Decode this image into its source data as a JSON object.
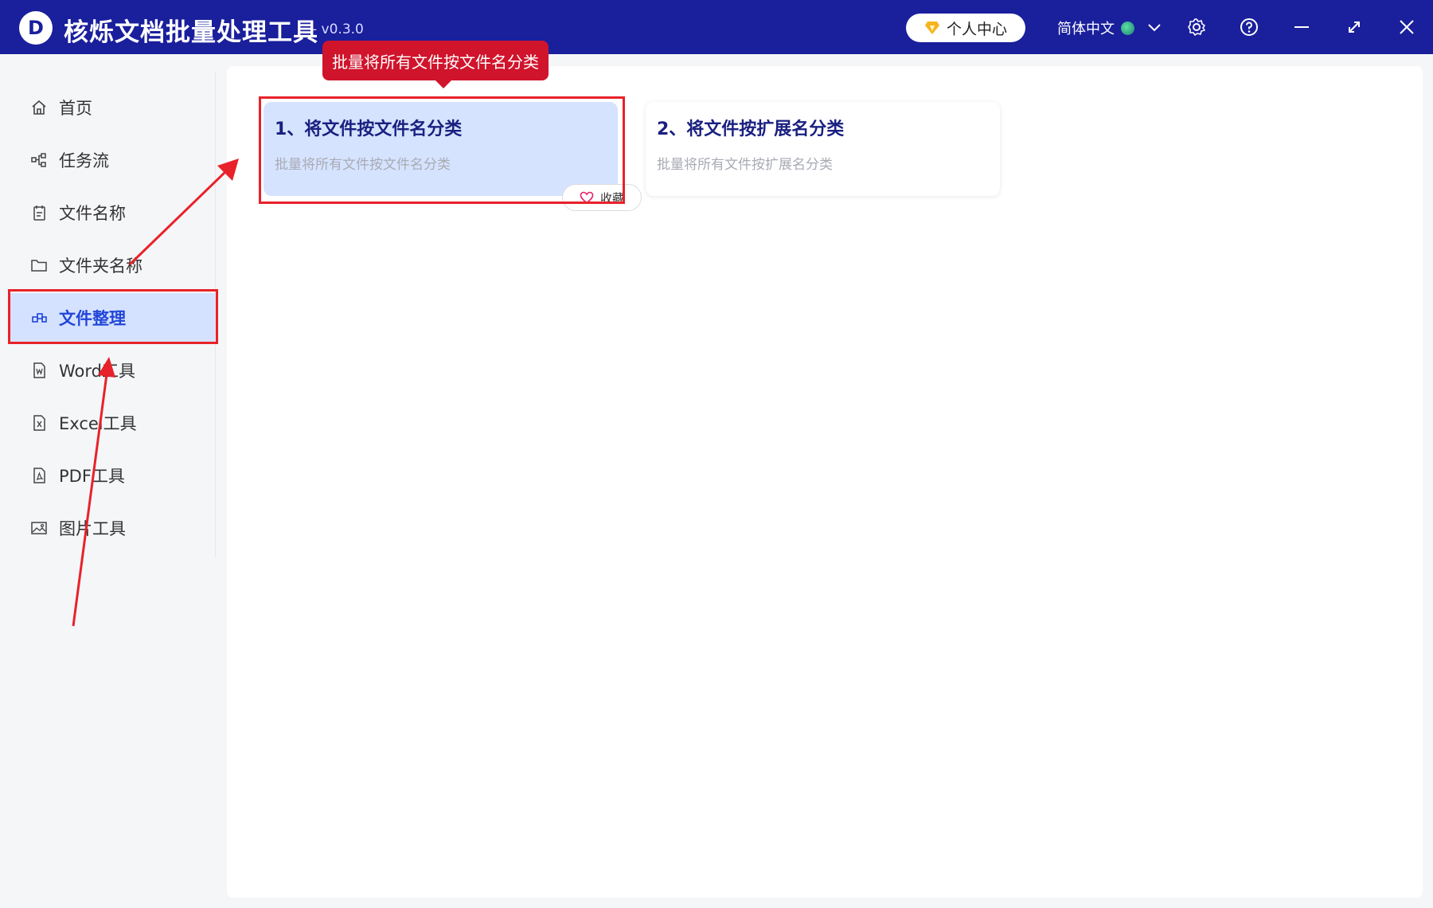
{
  "window": {
    "logo_letter": "D",
    "title": "核烁文档批量处理工具",
    "version": "- v0.3.0",
    "vip_label": "个人中心",
    "language": "简体中文",
    "icons": [
      "settings-icon",
      "help-icon",
      "minimize-icon",
      "maximize-icon",
      "close-icon"
    ]
  },
  "sidebar": {
    "items": [
      {
        "label": "首页",
        "icon": "home-icon",
        "active": false
      },
      {
        "label": "任务流",
        "icon": "workflow-icon",
        "active": false
      },
      {
        "label": "文件名称",
        "icon": "file-name-icon",
        "active": false
      },
      {
        "label": "文件夹名称",
        "icon": "folder-icon",
        "active": false
      },
      {
        "label": "文件整理",
        "icon": "organize-icon",
        "active": true
      },
      {
        "label": "Word工具",
        "icon": "word-file-icon",
        "active": false
      },
      {
        "label": "Excel工具",
        "icon": "excel-file-icon",
        "active": false
      },
      {
        "label": "PDF工具",
        "icon": "pdf-file-icon",
        "active": false
      },
      {
        "label": "图片工具",
        "icon": "image-icon",
        "active": false
      }
    ]
  },
  "main": {
    "tooltip": "批量将所有文件按文件名分类",
    "cards": [
      {
        "title": "1、将文件按文件名分类",
        "desc": "批量将所有文件按文件名分类",
        "selected": true
      },
      {
        "title": "2、将文件按扩展名分类",
        "desc": "批量将所有文件按扩展名分类",
        "selected": false
      }
    ],
    "favorite_label": "收藏"
  },
  "colors": {
    "titlebar": "#1a1f9c",
    "accent": "#2146d8",
    "annotation": "#e8222a",
    "tooltip": "#d0142c"
  }
}
